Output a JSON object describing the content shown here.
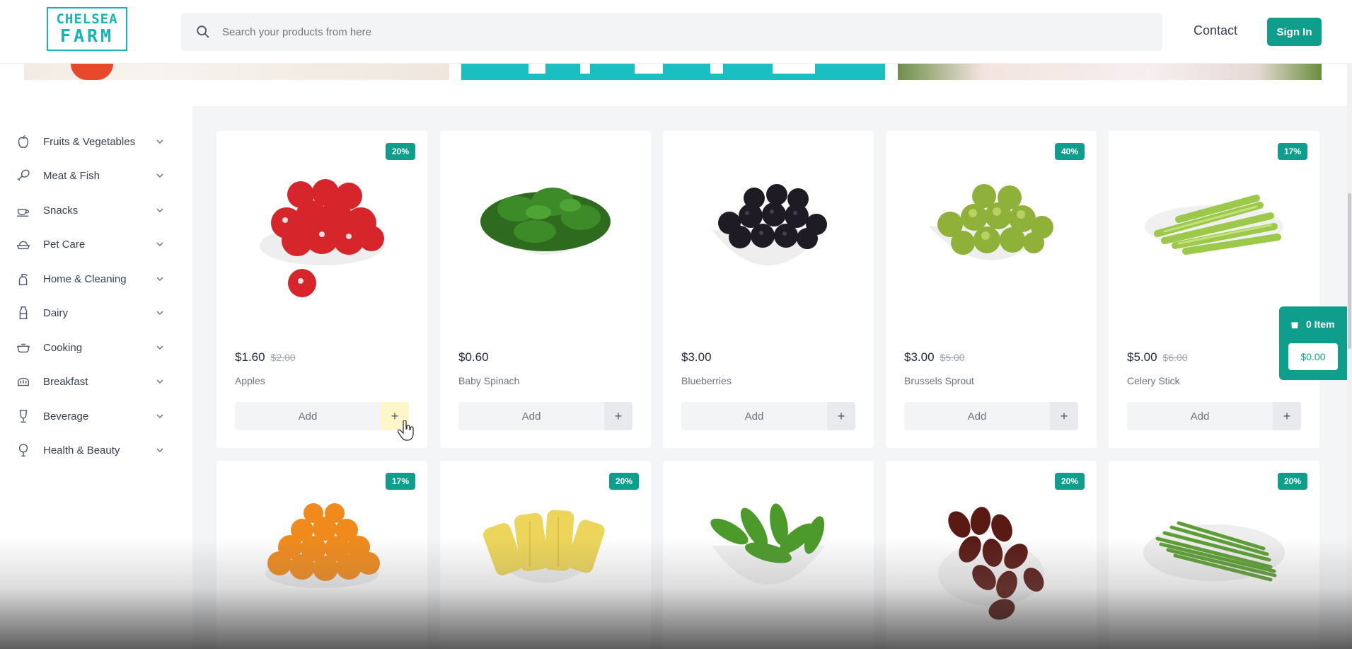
{
  "header": {
    "logo_line1": "CHELSEA",
    "logo_line2": "FARM",
    "search_placeholder": "Search your products from here",
    "contact_label": "Contact",
    "signin_label": "Sign In"
  },
  "colors": {
    "accent": "#0f9e8b",
    "logo": "#17b3b6"
  },
  "sidebar": {
    "categories": [
      {
        "label": "Fruits & Vegetables",
        "icon": "apple-icon"
      },
      {
        "label": "Meat & Fish",
        "icon": "drumstick-icon"
      },
      {
        "label": "Snacks",
        "icon": "cup-icon"
      },
      {
        "label": "Pet Care",
        "icon": "pet-bowl-icon"
      },
      {
        "label": "Home & Cleaning",
        "icon": "spray-bottle-icon"
      },
      {
        "label": "Dairy",
        "icon": "milk-bottle-icon"
      },
      {
        "label": "Cooking",
        "icon": "pot-icon"
      },
      {
        "label": "Breakfast",
        "icon": "bread-icon"
      },
      {
        "label": "Beverage",
        "icon": "glass-icon"
      },
      {
        "label": "Health & Beauty",
        "icon": "mirror-icon"
      }
    ]
  },
  "products": [
    {
      "name": "Apples",
      "price": "$1.60",
      "old_price": "$2.00",
      "discount": "20%",
      "add_label": "Add"
    },
    {
      "name": "Baby Spinach",
      "price": "$0.60",
      "old_price": "",
      "discount": "",
      "add_label": "Add"
    },
    {
      "name": "Blueberries",
      "price": "$3.00",
      "old_price": "",
      "discount": "",
      "add_label": "Add"
    },
    {
      "name": "Brussels Sprout",
      "price": "$3.00",
      "old_price": "$5.00",
      "discount": "40%",
      "add_label": "Add"
    },
    {
      "name": "Celery Stick",
      "price": "$5.00",
      "old_price": "$6.00",
      "discount": "17%",
      "add_label": "Add"
    },
    {
      "discount": "17%"
    },
    {
      "discount": "20%"
    },
    {
      "discount": ""
    },
    {
      "discount": "20%"
    },
    {
      "discount": "20%"
    }
  ],
  "cart": {
    "items_label": "0 Item",
    "total": "$0.00"
  }
}
